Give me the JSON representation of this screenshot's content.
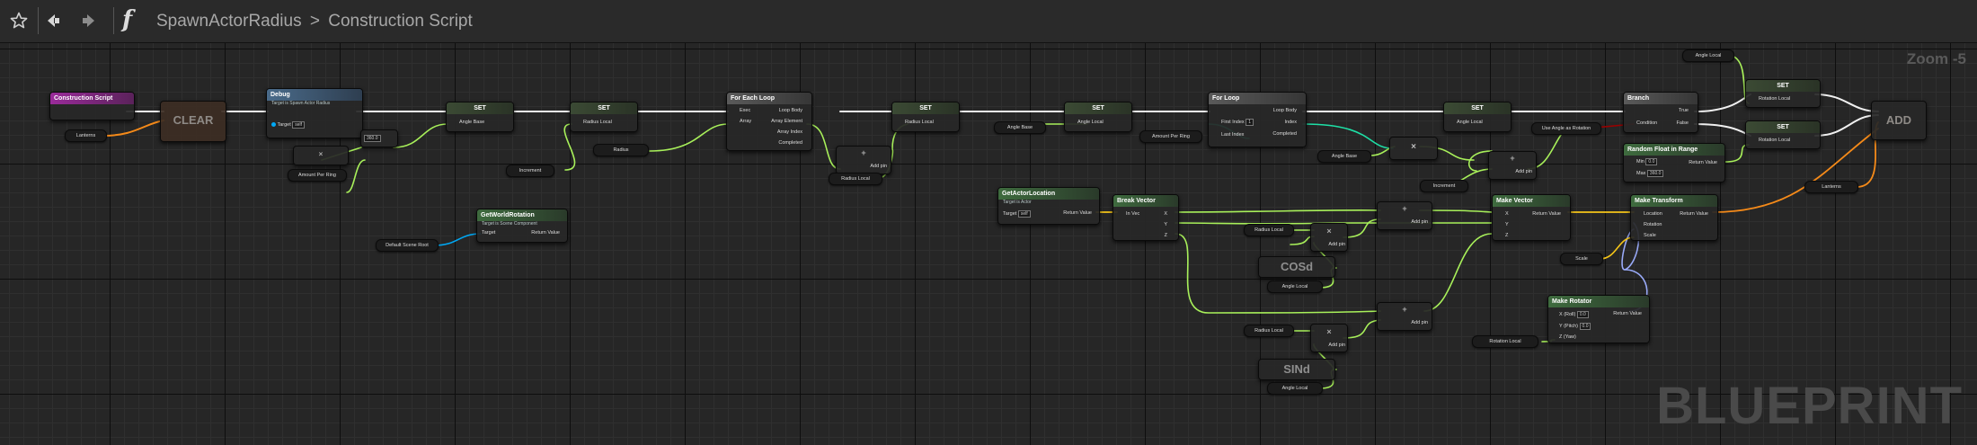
{
  "toolbar": {
    "favorite_icon": "star-outline-icon",
    "back_icon": "back-arrow-icon",
    "forward_icon": "forward-arrow-icon",
    "function_glyph": "f",
    "breadcrumb_root": "SpawnActorRadius",
    "breadcrumb_separator": ">",
    "breadcrumb_current": "Construction Script"
  },
  "zoom_label": "Zoom -5",
  "watermark": "BLUEPRINT",
  "colors": {
    "exec_wire": "#f4f4f4",
    "float_pin": "#a8f05a",
    "object_pin": "#00a8f4",
    "vector_pin": "#f5c518",
    "rotator_pin": "#99aaf8",
    "transform_pin": "#f58a19",
    "array_pin": "#f58a19",
    "bool_pin": "#9a0000",
    "int_pin": "#1ee0a6",
    "event_header": "#9a2b9a",
    "func_header": "#4a6b8a",
    "pure_header": "#3e6b3e",
    "var_header": "#3b4a34"
  },
  "nodes": {
    "construction": {
      "title": "Construction Script"
    },
    "clear": {
      "label": "CLEAR",
      "array_var": "Lanterns"
    },
    "debug": {
      "title": "Debug",
      "subtitle": "Target is Spawn Actor Radius",
      "target_label": "Target",
      "target_value": "self"
    },
    "set1": {
      "title": "SET",
      "pin": "Angle Base"
    },
    "set2": {
      "title": "SET",
      "pin": "Radius Local"
    },
    "divide1": {
      "field": "360.0"
    },
    "multiply1": {
      "op": "×",
      "input_var": "Amount Per Ring"
    },
    "increment1": {
      "label": "Increment"
    },
    "radius_var": {
      "label": "Radius"
    },
    "foreach": {
      "title": "For Each Loop",
      "exec": "Exec",
      "array": "Array",
      "loop_body": "Loop Body",
      "array_element": "Array Element",
      "array_index": "Array Index",
      "completed": "Completed"
    },
    "add1": {
      "op": "+",
      "label": "Add pin"
    },
    "radius_local1": {
      "label": "Radius Local"
    },
    "set3": {
      "title": "SET",
      "pin": "Radius Local"
    },
    "set4": {
      "title": "SET",
      "pin": "Angle Local"
    },
    "angle_base_var1": {
      "label": "Angle Base"
    },
    "forloop": {
      "title": "For Loop",
      "first_index": "First Index",
      "last_index": "Last Index",
      "loop_body": "Loop Body",
      "index": "Index",
      "completed": "Completed",
      "first_value": "1"
    },
    "amount_per_ring_var": {
      "label": "Amount Per Ring"
    },
    "multiply2": {
      "op": "×"
    },
    "angle_base_var2": {
      "label": "Angle Base"
    },
    "add2": {
      "op": "+",
      "label": "Add pin"
    },
    "increment2": {
      "label": "Increment"
    },
    "set5": {
      "title": "SET",
      "pin": "Angle Local"
    },
    "use_angle_var": {
      "label": "Use Angle as Rotation"
    },
    "branch": {
      "title": "Branch",
      "condition": "Condition",
      "true_label": "True",
      "false_label": "False"
    },
    "angle_local_top": {
      "label": "Angle Local"
    },
    "set6": {
      "title": "SET",
      "pin": "Rotation Local"
    },
    "set7": {
      "title": "SET",
      "pin": "Rotation Local"
    },
    "random_float": {
      "title": "Random Float in Range",
      "min_label": "Min",
      "min_value": "0.0",
      "max_label": "Max",
      "max_value": "360.0",
      "return_label": "Return Value"
    },
    "add_array": {
      "label": "ADD"
    },
    "lanterns_var2": {
      "label": "Lanterns"
    },
    "get_world_rotation": {
      "title": "GetWorldRotation",
      "subtitle": "Target is Scene Component",
      "target": "Target",
      "return": "Return Value"
    },
    "default_scene_root": {
      "label": "Default Scene Root"
    },
    "get_actor_location": {
      "title": "GetActorLocation",
      "subtitle": "Target is Actor",
      "target": "Target",
      "target_value": "self",
      "return": "Return Value"
    },
    "break_vector": {
      "title": "Break Vector",
      "in_vec": "In Vec",
      "x": "X",
      "y": "Y",
      "z": "Z"
    },
    "radius_local2": {
      "label": "Radius Local"
    },
    "cos": {
      "label": "COSd"
    },
    "angle_local2": {
      "label": "Angle Local"
    },
    "mul3": {
      "op": "×",
      "label": "Add pin"
    },
    "add3": {
      "op": "+",
      "label": "Add pin"
    },
    "radius_local3": {
      "label": "Radius Local"
    },
    "sin": {
      "label": "SINd"
    },
    "angle_local3": {
      "label": "Angle Local"
    },
    "mul4": {
      "op": "×",
      "label": "Add pin"
    },
    "add4": {
      "op": "+",
      "label": "Add pin"
    },
    "make_vector": {
      "title": "Make Vector",
      "x": "X",
      "y": "Y",
      "z": "Z",
      "return": "Return Value"
    },
    "make_transform": {
      "title": "Make Transform",
      "location": "Location",
      "rotation": "Rotation",
      "scale": "Scale",
      "return": "Return Value"
    },
    "scale_var": {
      "label": "Scale"
    },
    "make_rotator": {
      "title": "Make Rotator",
      "x": "X (Roll)",
      "y": "Y (Pitch)",
      "z": "Z (Yaw)",
      "x_value": "0.0",
      "y_value": "0.0",
      "return": "Return Value"
    },
    "rotation_local_var": {
      "label": "Rotation Local"
    }
  }
}
